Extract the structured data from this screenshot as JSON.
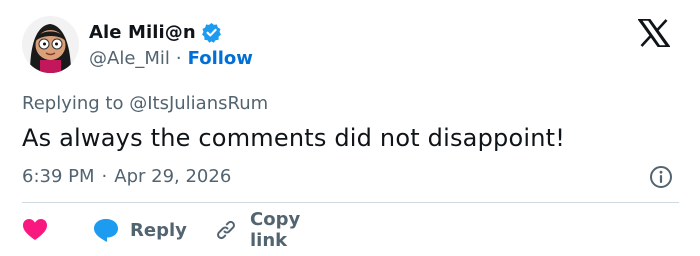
{
  "author": {
    "display_name": "Ale Mili@n",
    "handle": "@Ale_Mil",
    "separator": "·",
    "follow_label": "Follow"
  },
  "reply_context": {
    "prefix": "Replying to",
    "target": "@ItsJuliansRum"
  },
  "tweet": {
    "text": "As always the comments did not disappoint!"
  },
  "meta": {
    "time": "6:39 PM",
    "separator": "·",
    "date": "Apr 29, 2026"
  },
  "actions": {
    "reply_label": "Reply",
    "copy_link_label": "Copy link"
  },
  "colors": {
    "verified": "#1d9bf0",
    "follow": "#006fd6",
    "heart": "#f91880",
    "reply_bubble": "#1d9bf0",
    "secondary_text": "#536471"
  },
  "icons": [
    "avatar",
    "verified-badge-icon",
    "x-logo-icon",
    "info-icon",
    "heart-icon",
    "reply-bubble-icon",
    "link-icon"
  ]
}
